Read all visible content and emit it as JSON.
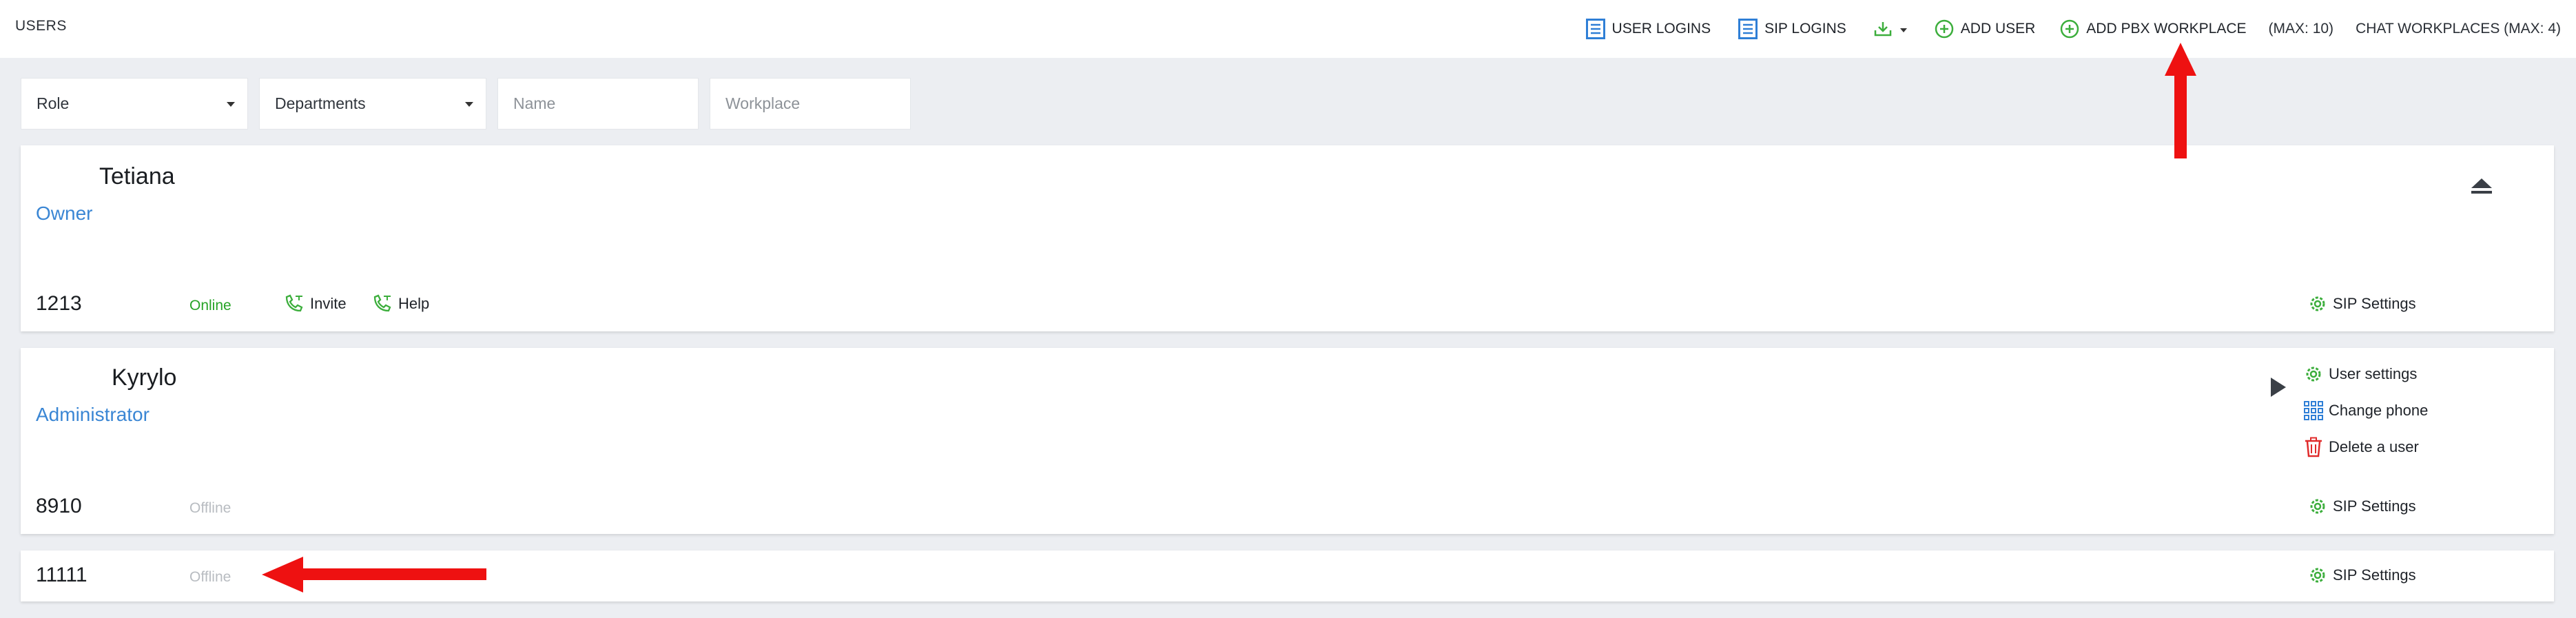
{
  "page": {
    "title": "USERS"
  },
  "toolbar": {
    "user_logins": "USER LOGINS",
    "sip_logins": "SIP LOGINS",
    "add_user": "ADD USER",
    "add_pbx": "ADD PBX WORKPLACE",
    "max_pbx": "(MAX: 10)",
    "chat_workplaces": "CHAT WORKPLACES (MAX: 4)"
  },
  "filters": {
    "role": "Role",
    "departments": "Departments",
    "name_placeholder": "Name",
    "workplace_placeholder": "Workplace"
  },
  "users": [
    {
      "name": "Tetiana",
      "role": "Owner",
      "extension": "1213",
      "status": "Online",
      "invite": "Invite",
      "help": "Help",
      "sip_settings": "SIP Settings"
    },
    {
      "name": "Kyrylo",
      "role": "Administrator",
      "extension": "8910",
      "status": "Offline",
      "user_settings": "User settings",
      "change_phone": "Change phone",
      "delete_user": "Delete a user",
      "sip_settings": "SIP Settings"
    },
    {
      "extension": "11111",
      "status": "Offline",
      "sip_settings": "SIP Settings"
    }
  ],
  "colors": {
    "accent_blue": "#3a86d4",
    "online_green": "#27a327",
    "icon_green": "#3cae3c",
    "delete_red": "#e02b2b",
    "annotation_red": "#ee1111"
  },
  "icons": {
    "user_logins": "list-icon",
    "sip_logins": "list-icon",
    "download": "download-icon",
    "add": "plus-circle-icon",
    "invite": "phone-icon",
    "help": "phone-icon",
    "sip_settings": "gear-icon",
    "user_settings": "gear-icon",
    "change_phone": "keypad-icon",
    "delete_user": "trash-icon",
    "collapse": "eject-icon",
    "expand": "play-icon"
  }
}
